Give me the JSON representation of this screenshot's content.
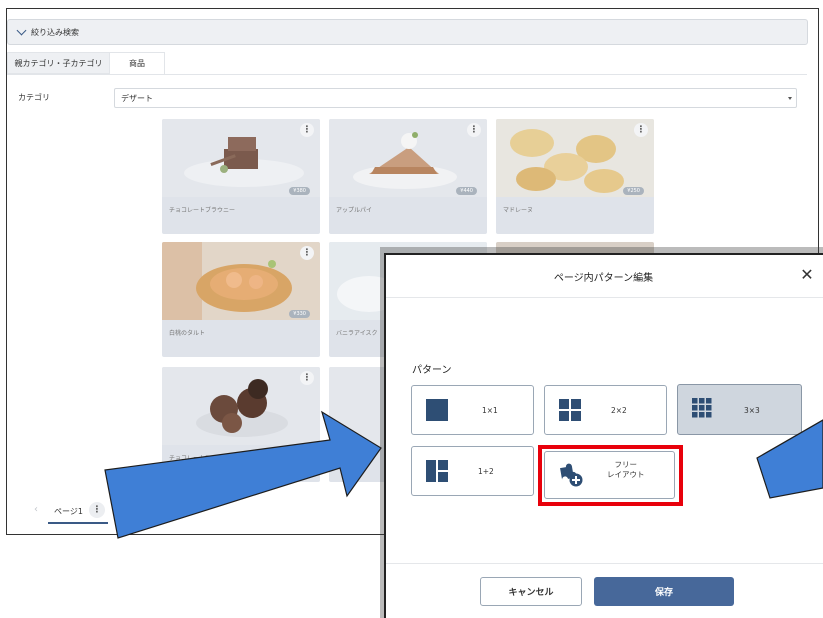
{
  "filter": {
    "label": "絞り込み検索"
  },
  "tabs": [
    {
      "label": "親カテゴリ・子カテゴリ"
    },
    {
      "label": "商品"
    }
  ],
  "category": {
    "label": "カテゴリ",
    "value": "デザート"
  },
  "products": [
    {
      "name": "チョコレートブラウニー",
      "price": "¥380"
    },
    {
      "name": "アップルパイ",
      "price": "¥440"
    },
    {
      "name": "マドレーヌ",
      "price": "¥250"
    },
    {
      "name": "白桃のタルト",
      "price": "¥330"
    },
    {
      "name": "バニラアイスク",
      "price": ""
    },
    {
      "name": "チョコレートア",
      "price": ""
    }
  ],
  "pager": {
    "label": "ページ1"
  },
  "dialog": {
    "title": "ページ内パターン編集",
    "pattern_label": "パターン",
    "patterns": [
      {
        "label": "1×1",
        "selected": false
      },
      {
        "label": "2×2",
        "selected": false
      },
      {
        "label": "3×3",
        "selected": true
      },
      {
        "label": "1+2",
        "selected": false
      },
      {
        "label": "フリー\nレイアウト",
        "selected": false
      }
    ],
    "cancel_label": "キャンセル",
    "save_label": "保存"
  },
  "colors": {
    "accent": "#47689a",
    "highlight": "#e8000b",
    "arrow": "#3f7fd6",
    "icon": "#2e4e74"
  },
  "icons": {
    "kebab": "kebab-icon",
    "close": "close-icon",
    "free_layout": "puzzle-plus-icon"
  }
}
